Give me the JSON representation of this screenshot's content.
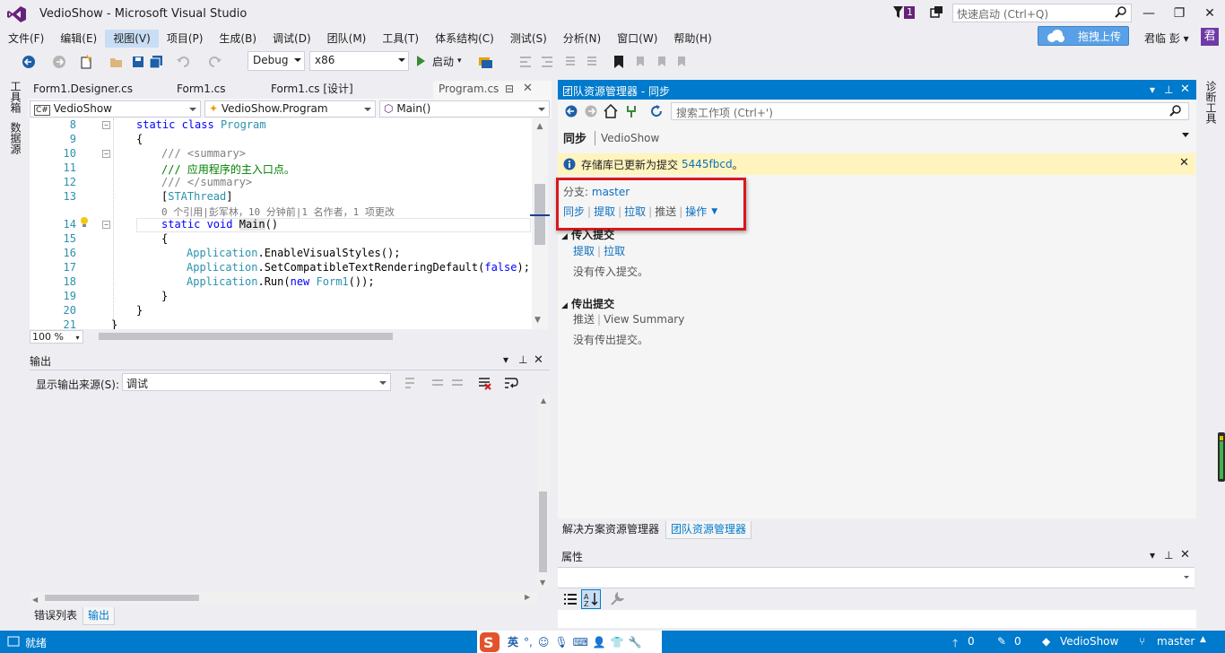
{
  "window": {
    "title": "VedioShow - Microsoft Visual Studio",
    "notify_count": "1",
    "quick_launch_placeholder": "快速启动 (Ctrl+Q)"
  },
  "menu": [
    "文件(F)",
    "编辑(E)",
    "视图(V)",
    "项目(P)",
    "生成(B)",
    "调试(D)",
    "团队(M)",
    "工具(T)",
    "体系结构(C)",
    "测试(S)",
    "分析(N)",
    "窗口(W)",
    "帮助(H)"
  ],
  "menu_selected": "视图(V)",
  "upload_label": "拖拽上传",
  "user": {
    "name": "君临 彭",
    "avatar": "君"
  },
  "toolbar": {
    "config": "Debug",
    "platform": "x86",
    "start": "启动"
  },
  "left_rail": [
    "工具箱",
    "数据源"
  ],
  "tabs": [
    {
      "label": "Form1.Designer.cs"
    },
    {
      "label": "Form1.cs"
    },
    {
      "label": "Form1.cs [设计]"
    },
    {
      "label": "Program.cs"
    }
  ],
  "nav": {
    "project": "VedioShow",
    "class": "VedioShow.Program",
    "member": "Main()"
  },
  "code": {
    "line_numbers": [
      "8",
      "9",
      "10",
      "11",
      "12",
      "13",
      "14",
      "15",
      "16",
      "17",
      "18",
      "19",
      "20",
      "21"
    ],
    "l8_kw": "static class",
    "l8_tp": "Program",
    "l9": "{",
    "l10_a": "/// ",
    "l10_b": "<summary>",
    "l11": "/// 应用程序的主入口点。",
    "l12_a": "/// ",
    "l12_b": "</summary>",
    "l13_a": "[",
    "l13_b": "STAThread",
    "l13_c": "]",
    "lens": "0 个引用|彭军林，10 分钟前|1 名作者，1 项更改",
    "l14_kw": "static void",
    "l14_name": "Main",
    "l14_rest": "()",
    "l15": "{",
    "l16_tp": "Application",
    "l16_rest": ".EnableVisualStyles();",
    "l17_tp": "Application",
    "l17_a": ".SetCompatibleTextRenderingDefault(",
    "l17_kw": "false",
    "l17_b": ");",
    "l18_tp": "Application",
    "l18_a": ".Run(",
    "l18_kw": "new",
    "l18_tp2": "Form1",
    "l18_b": "());",
    "l19": "}",
    "l20": "}",
    "l21": "}"
  },
  "zoom": "100 %",
  "output": {
    "title": "输出",
    "source_label": "显示输出来源(S):",
    "source_value": "调试"
  },
  "bottom_tabs": [
    "错误列表",
    "输出"
  ],
  "team": {
    "title": "团队资源管理器 - 同步",
    "search_placeholder": "搜索工作项 (Ctrl+')",
    "page": "同步",
    "project": "VedioShow",
    "info_text": "存储库已更新为提交",
    "info_commit": "5445fbcd",
    "info_end": "。",
    "branch_label": "分支:",
    "branch": "master",
    "actions": [
      "同步",
      "提取",
      "拉取",
      "推送",
      "操作"
    ],
    "incoming": {
      "title": "传入提交",
      "links": [
        "提取",
        "拉取"
      ],
      "empty": "没有传入提交。"
    },
    "outgoing": {
      "title": "传出提交",
      "links": [
        "推送",
        "View Summary"
      ],
      "empty": "没有传出提交。"
    }
  },
  "team_tabs": [
    "解决方案资源管理器",
    "团队资源管理器"
  ],
  "properties": {
    "title": "属性"
  },
  "right_rail": [
    "诊断工具"
  ],
  "status": {
    "ready": "就绪",
    "up": "0",
    "edits": "0",
    "repo": "VedioShow",
    "branch": "master"
  },
  "ime": {
    "lang": "英"
  }
}
